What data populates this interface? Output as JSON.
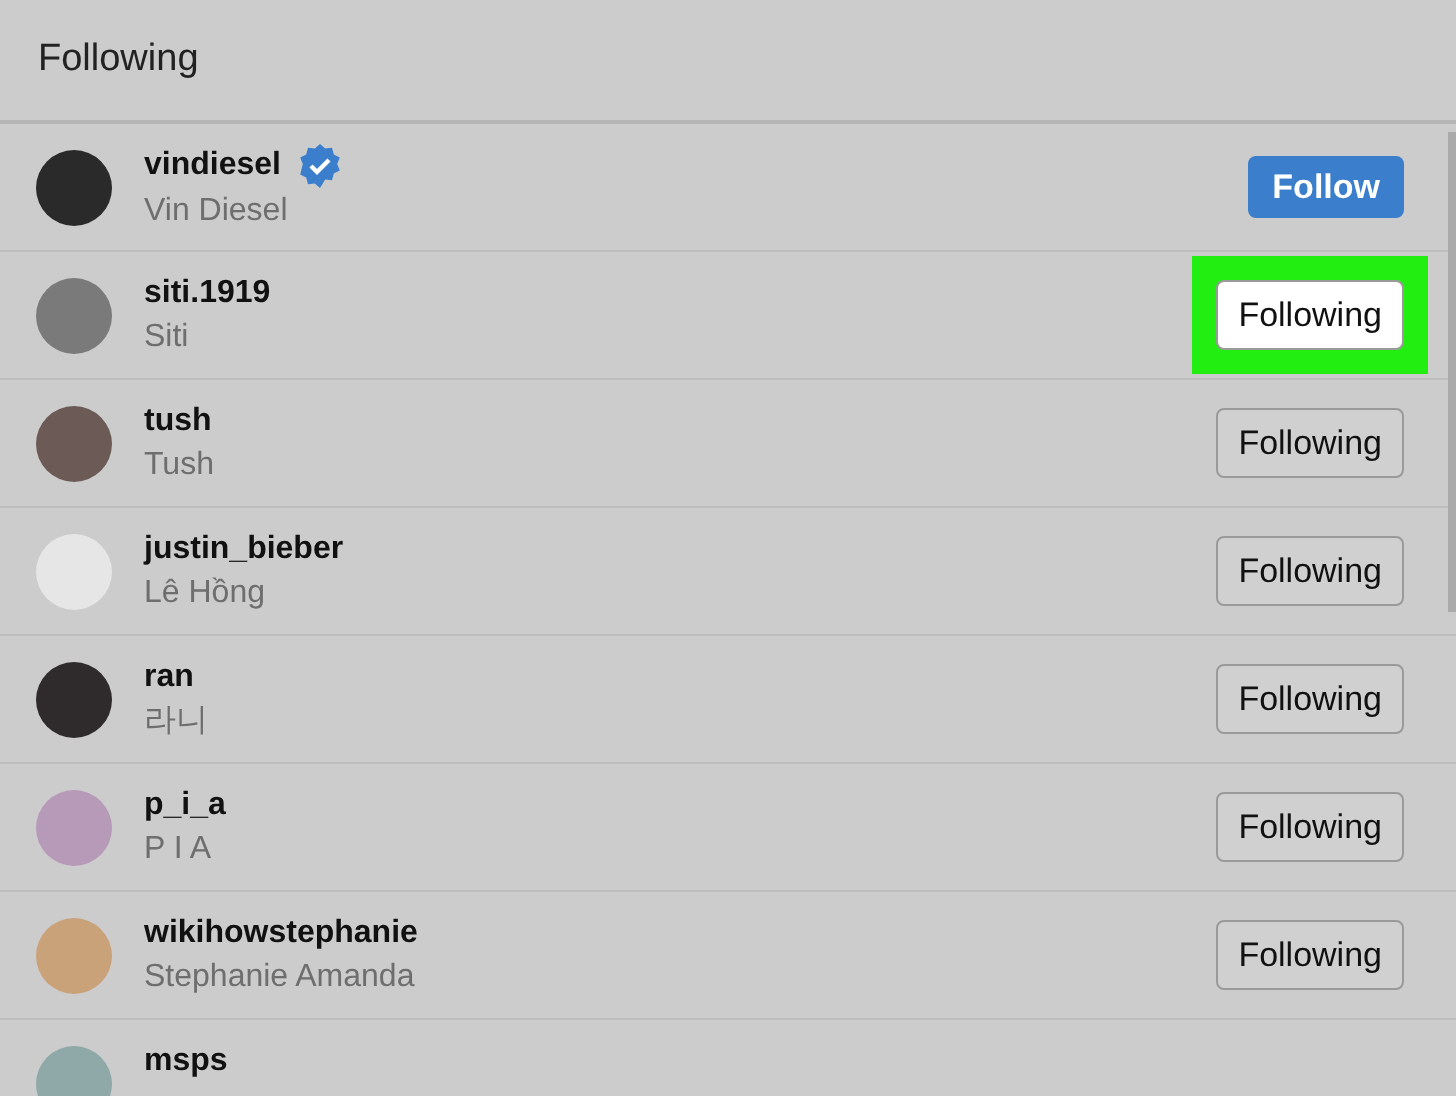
{
  "title": "Following",
  "users": [
    {
      "username": "vindiesel",
      "name": "Vin Diesel",
      "verified": true,
      "button": {
        "kind": "follow",
        "label": "Follow"
      },
      "highlighted": false,
      "color": "#2a2a2a"
    },
    {
      "username": "siti.1919",
      "name": "Siti",
      "verified": false,
      "button": {
        "kind": "following",
        "label": "Following"
      },
      "highlighted": true,
      "color": "#7a7a7a"
    },
    {
      "username": "tush",
      "name": "Tush",
      "verified": false,
      "button": {
        "kind": "following",
        "label": "Following"
      },
      "highlighted": false,
      "color": "#6b5a55"
    },
    {
      "username": "justin_bieber",
      "name": "Lê Hồng",
      "verified": false,
      "button": {
        "kind": "following",
        "label": "Following"
      },
      "highlighted": false,
      "color": "#e6e6e6"
    },
    {
      "username": "ran",
      "name": "라니",
      "verified": false,
      "button": {
        "kind": "following",
        "label": "Following"
      },
      "highlighted": false,
      "color": "#2f2a2c"
    },
    {
      "username": "p_i_a",
      "name": "P I A",
      "verified": false,
      "button": {
        "kind": "following",
        "label": "Following"
      },
      "highlighted": false,
      "color": "#b79ab8"
    },
    {
      "username": "wikihowstephanie",
      "name": "Stephanie Amanda",
      "verified": false,
      "button": {
        "kind": "following",
        "label": "Following"
      },
      "highlighted": false,
      "color": "#c9a27a"
    },
    {
      "username": "msps",
      "verified": false,
      "highlighted": false,
      "color": "#8fa8a8"
    }
  ]
}
